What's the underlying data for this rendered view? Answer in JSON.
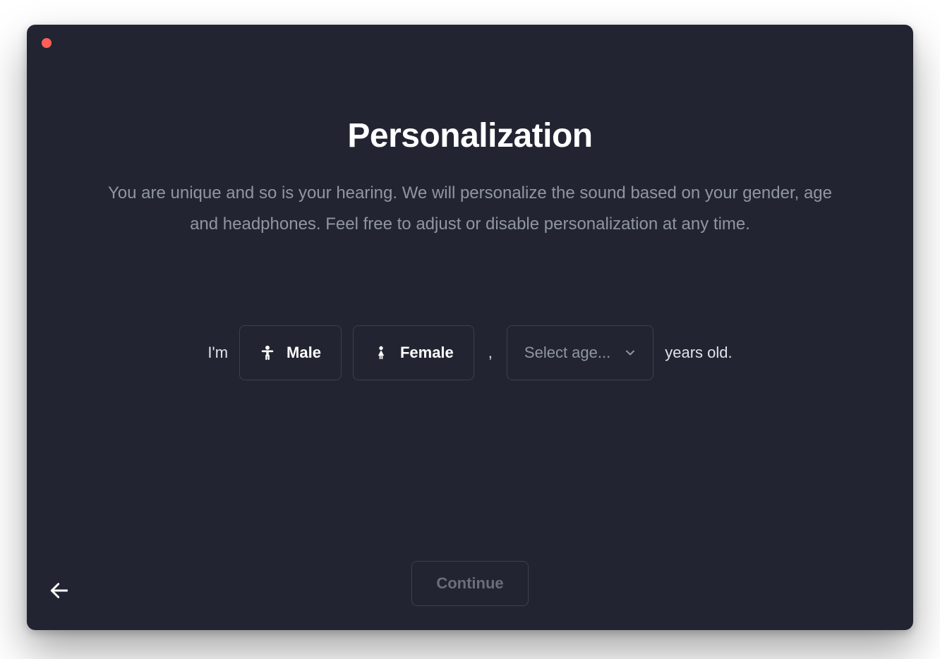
{
  "header": {
    "title": "Personalization",
    "subtitle": "You are unique and so is your hearing. We will personalize the sound based on your gender, age and headphones. Feel free to adjust or disable personalization at any time."
  },
  "form": {
    "prefix": "I'm",
    "male_label": "Male",
    "female_label": "Female",
    "separator": ",",
    "age_placeholder": "Select age...",
    "suffix": "years old."
  },
  "actions": {
    "continue_label": "Continue"
  }
}
